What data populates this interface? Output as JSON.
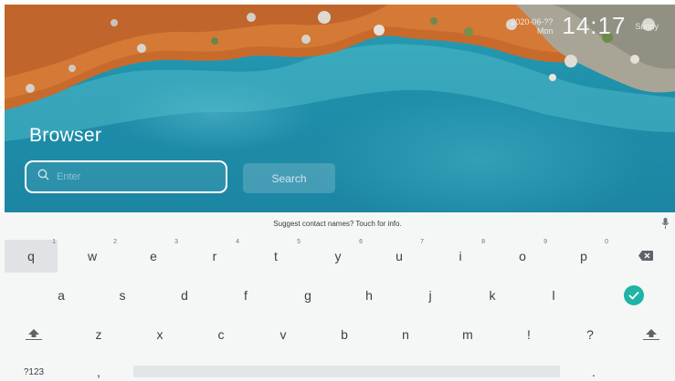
{
  "status": {
    "date": "2020-06-??",
    "weekday": "Mon",
    "time": "14:17",
    "weather": "Sunny"
  },
  "app": {
    "title": "Browser"
  },
  "search": {
    "placeholder": "Enter",
    "button_label": "Search"
  },
  "keyboard": {
    "suggestion": "Suggest contact names? Touch for info.",
    "row1": [
      {
        "key": "q",
        "hint": "1"
      },
      {
        "key": "w",
        "hint": "2"
      },
      {
        "key": "e",
        "hint": "3"
      },
      {
        "key": "r",
        "hint": "4"
      },
      {
        "key": "t",
        "hint": "5"
      },
      {
        "key": "y",
        "hint": "6"
      },
      {
        "key": "u",
        "hint": "7"
      },
      {
        "key": "i",
        "hint": "8"
      },
      {
        "key": "o",
        "hint": "9"
      },
      {
        "key": "p",
        "hint": "0"
      }
    ],
    "row2": [
      "a",
      "s",
      "d",
      "f",
      "g",
      "h",
      "j",
      "k",
      "l"
    ],
    "row3": [
      "z",
      "x",
      "c",
      "v",
      "b",
      "n",
      "m",
      "!",
      "?"
    ],
    "symbols_label": "?123",
    "comma_label": ",",
    "period_label": ".",
    "icons": {
      "backspace": "backspace-icon",
      "enter": "check-enter-icon",
      "shift": "shift-arrow-icon",
      "mic": "microphone-icon"
    },
    "accent_color": "#1fb4a5"
  }
}
